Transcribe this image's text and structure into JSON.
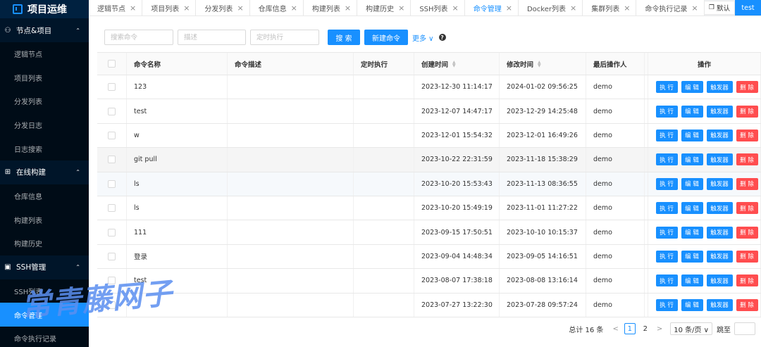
{
  "sidebar": {
    "brand": "项目运维",
    "groups": [
      {
        "label": "节点&项目",
        "icon": "sitemap-icon",
        "items": [
          "逻辑节点",
          "项目列表",
          "分发列表",
          "分发日志",
          "日志搜索"
        ]
      },
      {
        "label": "在线构建",
        "icon": "build-icon",
        "items": [
          "仓库信息",
          "构建列表",
          "构建历史"
        ]
      },
      {
        "label": "SSH管理",
        "icon": "terminal-icon",
        "items": [
          "SSH列表",
          "命令管理",
          "命令执行记录"
        ]
      }
    ],
    "active_item": "命令管理"
  },
  "tabs": {
    "items": [
      "逻辑节点",
      "项目列表",
      "分发列表",
      "仓库信息",
      "构建列表",
      "构建历史",
      "SSH列表",
      "命令管理",
      "Docker列表",
      "集群列表",
      "命令执行记录"
    ],
    "active": "命令管理",
    "close_glyph": "×",
    "extra_label": "默认",
    "user": "test"
  },
  "toolbar": {
    "search_placeholder": "搜索命令",
    "desc_placeholder": "描述",
    "timer_placeholder": "定时执行",
    "search_button": "搜 索",
    "new_button": "新建命令",
    "more_label": "更多 ∨",
    "help_glyph": "?"
  },
  "table": {
    "headers": {
      "name": "命令名称",
      "desc": "命令描述",
      "timer": "定时执行",
      "create": "创建时间",
      "modify": "修改时间",
      "operator": "最后操作人",
      "actions": "操作"
    },
    "action_labels": {
      "run": "执 行",
      "edit": "编 辑",
      "trigger": "触发器",
      "delete": "删 除"
    },
    "rows": [
      {
        "name": "123",
        "desc": "",
        "timer": "",
        "create": "2023-12-30 11:14:17",
        "modify": "2024-01-02 09:56:25",
        "operator": "demo"
      },
      {
        "name": "test",
        "desc": "",
        "timer": "",
        "create": "2023-12-07 14:47:17",
        "modify": "2023-12-29 14:25:48",
        "operator": "demo"
      },
      {
        "name": "w",
        "desc": "",
        "timer": "",
        "create": "2023-12-01 15:54:32",
        "modify": "2023-12-01 16:49:26",
        "operator": "demo"
      },
      {
        "name": "git pull",
        "desc": "",
        "timer": "",
        "create": "2023-10-22 22:31:59",
        "modify": "2023-11-18 15:38:29",
        "operator": "demo"
      },
      {
        "name": "ls",
        "desc": "",
        "timer": "",
        "create": "2023-10-20 15:53:43",
        "modify": "2023-11-13 08:36:55",
        "operator": "demo"
      },
      {
        "name": "ls",
        "desc": "",
        "timer": "",
        "create": "2023-10-20 15:49:19",
        "modify": "2023-11-01 11:27:22",
        "operator": "demo"
      },
      {
        "name": "111",
        "desc": "",
        "timer": "",
        "create": "2023-09-15 17:50:51",
        "modify": "2023-10-10 10:15:37",
        "operator": "demo"
      },
      {
        "name": "登录",
        "desc": "",
        "timer": "",
        "create": "2023-09-04 14:48:34",
        "modify": "2023-09-05 14:16:51",
        "operator": "demo"
      },
      {
        "name": "test",
        "desc": "",
        "timer": "",
        "create": "2023-08-07 17:38:18",
        "modify": "2023-08-08 13:16:14",
        "operator": "demo"
      },
      {
        "name": "",
        "desc": "",
        "timer": "",
        "create": "2023-07-27 13:22:30",
        "modify": "2023-07-28 09:57:24",
        "operator": "demo"
      }
    ]
  },
  "pagination": {
    "total": "总计 16 条",
    "prev": "<",
    "pages": [
      "1",
      "2"
    ],
    "current": "1",
    "next": ">",
    "page_size": "10 条/页 ∨",
    "jump_label": "跳至"
  },
  "watermark": "常青藤网子"
}
